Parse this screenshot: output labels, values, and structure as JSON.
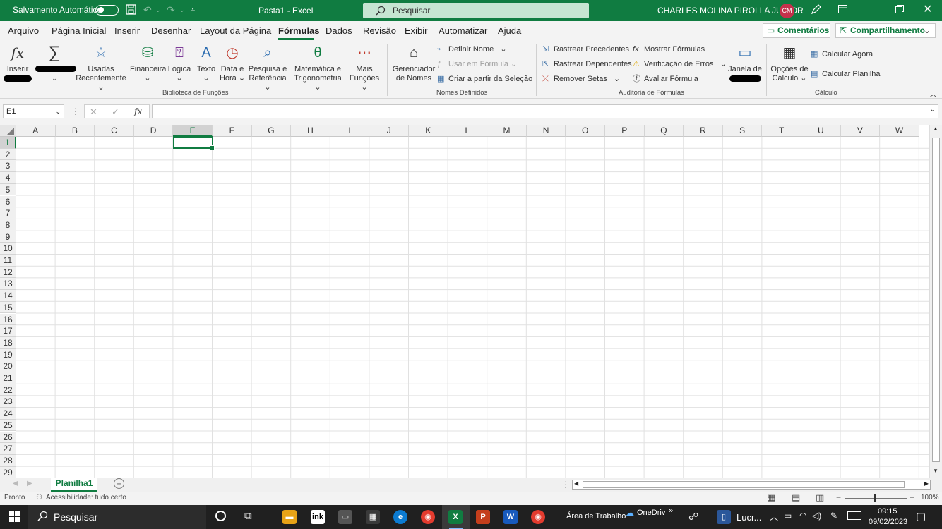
{
  "title_bar": {
    "autosave_label": "Salvamento Automático",
    "doc_title": "Pasta1  -  Excel",
    "search_placeholder": "Pesquisar",
    "user_name": "CHARLES MOLINA PIROLLA JUNIOR",
    "user_initials": "CM"
  },
  "menu": {
    "tabs": [
      "Arquivo",
      "Página Inicial",
      "Inserir",
      "Desenhar",
      "Layout da Página",
      "Fórmulas",
      "Dados",
      "Revisão",
      "Exibir",
      "Automatizar",
      "Ajuda"
    ],
    "active_tab": "Fórmulas",
    "comments_label": "Comentários",
    "share_label": "Compartilhamento"
  },
  "ribbon": {
    "insert_function": "Inserir",
    "recently_used_1": "Usadas",
    "recently_used_2": "Recentemente",
    "financial": "Financeira",
    "logical": "Lógica",
    "text": "Texto",
    "date_time_1": "Data e",
    "date_time_2": "Hora",
    "lookup_1": "Pesquisa e",
    "lookup_2": "Referência",
    "math_1": "Matemática e",
    "math_2": "Trigonometria",
    "more_1": "Mais",
    "more_2": "Funções",
    "group_library": "Biblioteca de Funções",
    "name_manager_1": "Gerenciador",
    "name_manager_2": "de Nomes",
    "define_name": "Definir Nome",
    "use_in_formula": "Usar em Fórmula",
    "create_from_selection": "Criar a partir da Seleção",
    "group_names": "Nomes Definidos",
    "trace_precedents": "Rastrear Precedentes",
    "trace_dependents": "Rastrear Dependentes",
    "remove_arrows": "Remover Setas",
    "show_formulas": "Mostrar Fórmulas",
    "error_checking": "Verificação de Erros",
    "evaluate_formula": "Avaliar Fórmula",
    "watch_window": "Janela de",
    "group_auditing": "Auditoria de Fórmulas",
    "calc_options_1": "Opções de",
    "calc_options_2": "Cálculo",
    "calc_now": "Calcular Agora",
    "calc_sheet": "Calcular Planilha",
    "group_calc": "Cálculo"
  },
  "formula_bar": {
    "name_box": "E1",
    "fx": "fx",
    "content": ""
  },
  "grid": {
    "columns": [
      "A",
      "B",
      "C",
      "D",
      "E",
      "F",
      "G",
      "H",
      "I",
      "J",
      "K",
      "L",
      "M",
      "N",
      "O",
      "P",
      "Q",
      "R",
      "S",
      "T",
      "U",
      "V",
      "W"
    ],
    "rows": [
      "1",
      "2",
      "3",
      "4",
      "5",
      "6",
      "7",
      "8",
      "9",
      "10",
      "11",
      "12",
      "13",
      "14",
      "15",
      "16",
      "17",
      "18",
      "19",
      "20",
      "21",
      "22",
      "23",
      "24",
      "25",
      "26",
      "27",
      "28",
      "29"
    ],
    "selected_column": "E",
    "selected_row": "1"
  },
  "sheets": {
    "tabs": [
      "Planilha1"
    ]
  },
  "status": {
    "mode": "Pronto",
    "accessibility": "Acessibilidade: tudo certo",
    "zoom": "100%"
  },
  "taskbar": {
    "search_label": "Pesquisar",
    "desktop_label": "Área de Trabalho",
    "onedrive_label": "OneDrive",
    "app_label": "Lucr...",
    "time": "09:15",
    "date": "09/02/2023"
  }
}
